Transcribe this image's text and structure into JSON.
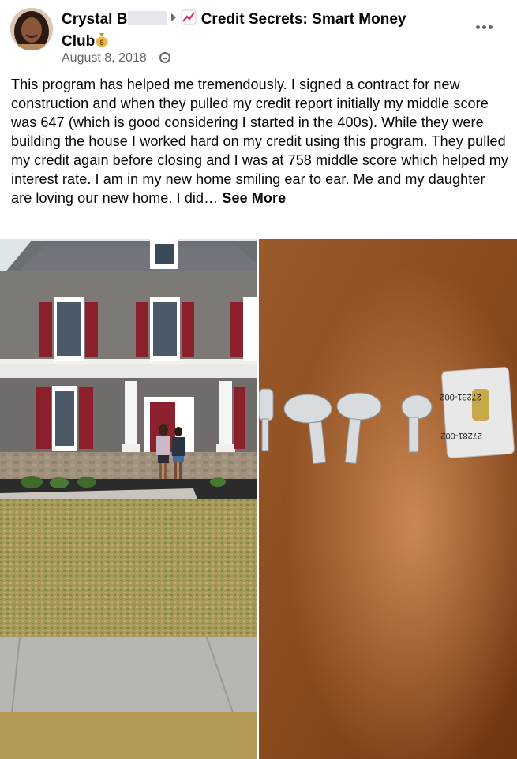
{
  "post": {
    "author_prefix": "Crystal B",
    "group_name": "Credit Secrets: Smart Money",
    "group_name_line2": "Club",
    "date": "August 8, 2018",
    "date_separator": "·",
    "privacy_icon": "globe-icon",
    "more_icon": "more-options-icon",
    "body": "This program has helped me tremendously. I signed a contract for new construction and when they pulled my credit report initially my middle score was 647 (which is good considering I started in the 400s). While they were building the house I worked hard on my credit using this program. They pulled my credit again before closing and I was at 758 middle score which helped my interest rate. I am in my new home smiling ear to ear. Me and my daughter are loving our new home. I did…",
    "see_more": "See More"
  },
  "photos": {
    "left_description_icon": "house-photo",
    "right_description_icon": "keys-photo"
  },
  "colors": {
    "text_primary": "#050505",
    "text_secondary": "#65676b",
    "redaction": "#e4e6eb"
  }
}
